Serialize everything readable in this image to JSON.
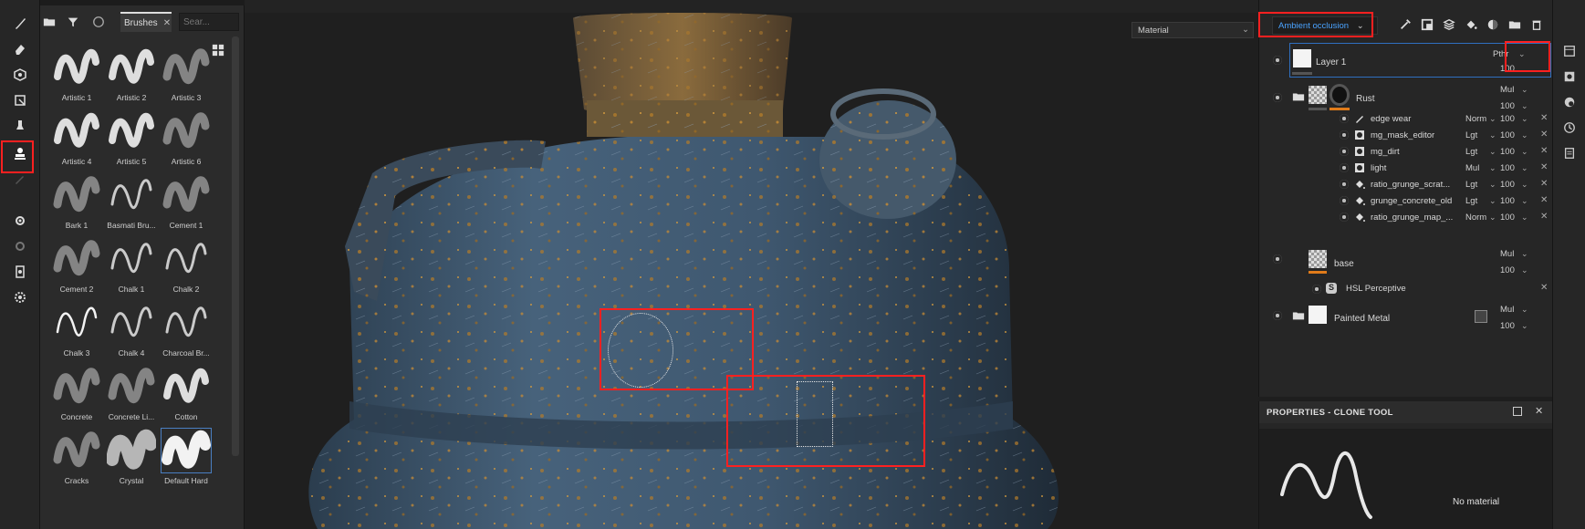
{
  "shelf": {
    "brushes_tab": "Brushes",
    "search_placeholder": "Sear...",
    "brushes": [
      {
        "label": "Artistic 1"
      },
      {
        "label": "Artistic 2"
      },
      {
        "label": "Artistic 3"
      },
      {
        "label": "Artistic 4"
      },
      {
        "label": "Artistic 5"
      },
      {
        "label": "Artistic 6"
      },
      {
        "label": "Bark 1"
      },
      {
        "label": "Basmati Bru..."
      },
      {
        "label": "Cement 1"
      },
      {
        "label": "Cement 2"
      },
      {
        "label": "Chalk 1"
      },
      {
        "label": "Chalk 2"
      },
      {
        "label": "Chalk 3"
      },
      {
        "label": "Chalk 4"
      },
      {
        "label": "Charcoal Br..."
      },
      {
        "label": "Concrete"
      },
      {
        "label": "Concrete Li..."
      },
      {
        "label": "Cotton"
      },
      {
        "label": "Cracks"
      },
      {
        "label": "Crystal"
      },
      {
        "label": "Default Hard"
      }
    ]
  },
  "viewport": {
    "material_select": "Material"
  },
  "layers": {
    "channel_select": "Ambient occlusion",
    "rows": {
      "layer1": {
        "name": "Layer 1",
        "blend": "Pthr",
        "opacity": "100"
      },
      "rust": {
        "name": "Rust",
        "blend": "Mul",
        "opacity": "100"
      },
      "edge_wear": {
        "name": "edge wear",
        "blend": "Norm",
        "opacity": "100"
      },
      "mg_mask_editor": {
        "name": "mg_mask_editor",
        "blend": "Lgt",
        "opacity": "100"
      },
      "mg_dirt": {
        "name": "mg_dirt",
        "blend": "Lgt",
        "opacity": "100"
      },
      "light": {
        "name": "light",
        "blend": "Mul",
        "opacity": "100"
      },
      "ratio_grunge_scrat": {
        "name": "ratio_grunge_scrat...",
        "blend": "Lgt",
        "opacity": "100"
      },
      "grunge_concrete_old": {
        "name": "grunge_concrete_old",
        "blend": "Lgt",
        "opacity": "100"
      },
      "ratio_grunge_map": {
        "name": "ratio_grunge_map_...",
        "blend": "Norm",
        "opacity": "100"
      },
      "base": {
        "name": "base",
        "blend": "Mul",
        "opacity": "100"
      },
      "hsl": {
        "name": "HSL Perceptive"
      },
      "painted_metal": {
        "name": "Painted Metal",
        "blend": "Mul",
        "opacity": "100"
      }
    }
  },
  "properties": {
    "title": "PROPERTIES - CLONE TOOL",
    "no_material": "No material"
  },
  "colors": {
    "accent_blue": "#4aa3ff",
    "mask_orange": "#e07b1a",
    "highlight_red": "#ff2020"
  }
}
